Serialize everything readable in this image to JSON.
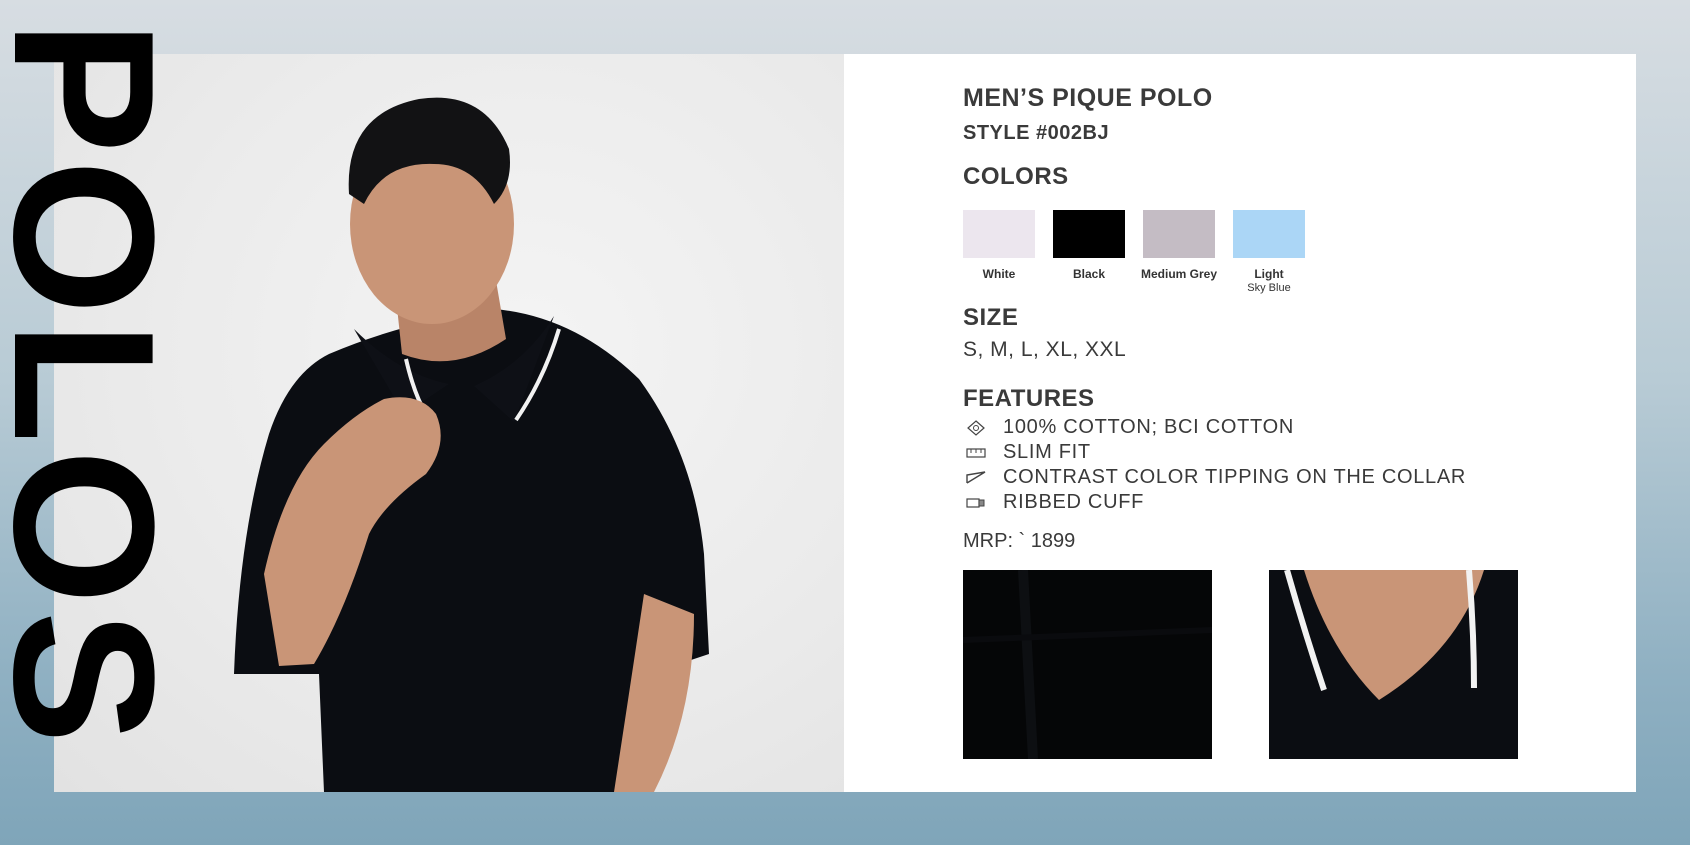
{
  "title": "POLOS",
  "product": {
    "name": "MEN’S PIQUE POLO",
    "style": "STYLE #002BJ"
  },
  "colors": {
    "heading": "COLORS",
    "items": [
      {
        "name": "White",
        "name_line2": "",
        "hex": "#ece6ee"
      },
      {
        "name": "Black",
        "name_line2": "",
        "hex": "#000000"
      },
      {
        "name": "Medium Grey",
        "name_line2": "",
        "hex": "#c4bcc4"
      },
      {
        "name": "Light",
        "name_line2": "Sky Blue",
        "hex": "#abd6f6"
      }
    ]
  },
  "size": {
    "heading": "SIZE",
    "values": "S, M, L, XL, XXL"
  },
  "features": {
    "heading": "FEATURES",
    "items": [
      {
        "icon": "cotton-icon",
        "text": "100% COTTON; BCI COTTON"
      },
      {
        "icon": "slim-fit-icon",
        "text": "SLIM FIT"
      },
      {
        "icon": "collar-icon",
        "text": "CONTRAST COLOR TIPPING ON THE COLLAR"
      },
      {
        "icon": "cuff-icon",
        "text": "RIBBED CUFF"
      }
    ]
  },
  "price": "MRP: ` 1899",
  "theme": {
    "text": "#3a3a3a",
    "shirt": "#0b0d12",
    "tipping": "#f2f2f2",
    "skin": "#c99577"
  }
}
